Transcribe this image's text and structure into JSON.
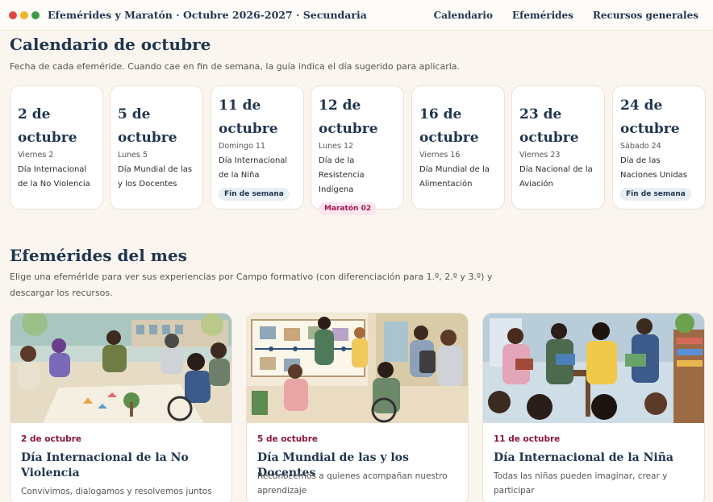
{
  "header": {
    "title": "Efemérides y Maratón · Octubre 2026-2027 · Secundaria",
    "dots": [
      "#e0463f",
      "#f0b429",
      "#3d9a48"
    ],
    "nav": [
      "Calendario",
      "Efemérides",
      "Recursos generales"
    ]
  },
  "calendar": {
    "title": "Calendario de octubre",
    "subtitle": "Fecha de cada efeméride. Cuando cae en fin de semana, la guía indica el día sugerido para aplicarla.",
    "cards": [
      {
        "date": "2 de octubre",
        "weekday": "Viernes 2",
        "name": "Día Internacional de la No Violencia",
        "badge": ""
      },
      {
        "date": "5 de octubre",
        "weekday": "Lunes 5",
        "name": "Día Mundial de las y los Docentes",
        "badge": ""
      },
      {
        "date": "11 de octubre",
        "weekday": "Domingo 11",
        "name": "Día Internacional de la Niña",
        "badge": "Fin de semana"
      },
      {
        "date": "12 de octubre",
        "weekday": "Lunes 12",
        "name": "Día de la Resistencia Indígena",
        "badge": "Maratón 02"
      },
      {
        "date": "16 de octubre",
        "weekday": "Viernes 16",
        "name": "Día Mundial de la Alimentación",
        "badge": ""
      },
      {
        "date": "23 de octubre",
        "weekday": "Viernes 23",
        "name": "Día Nacional de la Aviación",
        "badge": ""
      },
      {
        "date": "24 de octubre",
        "weekday": "Sábado 24",
        "name": "Día de las Naciones Unidas",
        "badge": "Fin de semana"
      }
    ]
  },
  "efemerides": {
    "title": "Efemérides del mes",
    "subtitle_line1": "Elige una efeméride para ver sus experiencias por Campo formativo (con diferenciación para 1.º, 2.º y 3.º) y",
    "subtitle_line2": "descargar los recursos.",
    "cards": [
      {
        "date": "2 de octubre",
        "title": "Día Internacional de la No Violencia",
        "desc": "Convivimos, dialogamos y resolvemos juntos"
      },
      {
        "date": "5 de octubre",
        "title": "Día Mundial de las y los Docentes",
        "desc": "Reconocemos a quienes acompañan nuestro aprendizaje"
      },
      {
        "date": "11 de octubre",
        "title": "Día Internacional de la Niña",
        "desc": "Todas las niñas pueden imaginar, crear y participar"
      }
    ]
  }
}
